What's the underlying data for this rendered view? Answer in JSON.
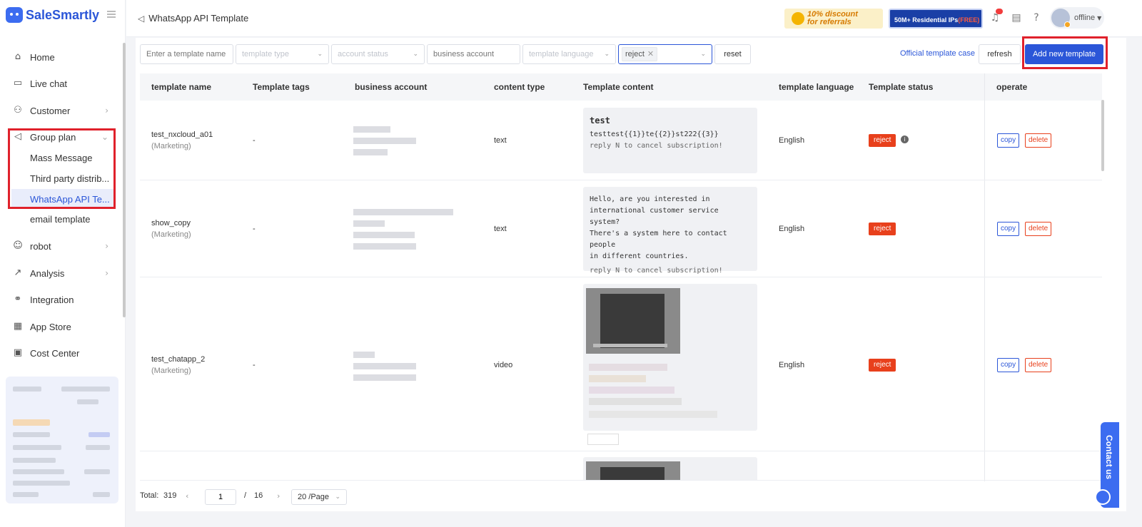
{
  "app": {
    "name": "SaleSmartly"
  },
  "header": {
    "page_title": "WhatsApp API Template",
    "promo_discount": "10% discount for referrals",
    "promo_discount_line1": "10% discount",
    "promo_discount_line2": "for referrals",
    "promo_ips": "50M+ Residential IPs",
    "promo_ips_free": "(FREE)",
    "user_status": "offline"
  },
  "sidebar": {
    "items": [
      {
        "label": "Home",
        "icon": "home-icon"
      },
      {
        "label": "Live chat",
        "icon": "chat-icon"
      },
      {
        "label": "Customer",
        "icon": "users-icon"
      },
      {
        "label": "Group plan",
        "icon": "send-icon"
      },
      {
        "label": "robot",
        "icon": "robot-icon"
      },
      {
        "label": "Analysis",
        "icon": "chart-icon"
      },
      {
        "label": "Integration",
        "icon": "integration-icon"
      },
      {
        "label": "App Store",
        "icon": "apps-icon"
      },
      {
        "label": "Cost Center",
        "icon": "wallet-icon"
      }
    ],
    "group_plan_children": [
      {
        "label": "Mass Message"
      },
      {
        "label": "Third party distrib..."
      },
      {
        "label": "WhatsApp API Te..."
      },
      {
        "label": "email template"
      }
    ]
  },
  "filters": {
    "template_name_placeholder": "Enter a template name",
    "template_type_placeholder": "template type",
    "account_status_placeholder": "account status",
    "business_account_placeholder": "business account",
    "template_language_placeholder": "template language",
    "status_selected": "reject",
    "reset_label": "reset"
  },
  "actions": {
    "official_case_link": "Official template case",
    "refresh_label": "refresh",
    "add_label": "Add new template"
  },
  "table": {
    "columns": [
      "template name",
      "Template tags",
      "business account",
      "content type",
      "Template content",
      "template language",
      "Template status",
      "operate"
    ],
    "rows": [
      {
        "name": "test_nxcloud_a01",
        "category": "(Marketing)",
        "tags": "-",
        "content_type": "text",
        "content_header": "test",
        "content_body": "testtest{{1}}te{{2}}st222{{3}}",
        "content_footer": "reply N to cancel subscription!",
        "language": "English",
        "status": "reject",
        "copy": "copy",
        "delete": "delete"
      },
      {
        "name": "show_copy",
        "category": "(Marketing)",
        "tags": "-",
        "content_type": "text",
        "content_body_lines": [
          "Hello, are you interested in",
          "international customer service system?",
          "There's a system here to contact people",
          "in different countries."
        ],
        "content_footer": "reply N to cancel subscription!",
        "language": "English",
        "status": "reject",
        "copy": "copy",
        "delete": "delete"
      },
      {
        "name": "test_chatapp_2",
        "category": "(Marketing)",
        "tags": "-",
        "content_type": "video",
        "language": "English",
        "status": "reject",
        "copy": "copy",
        "delete": "delete"
      }
    ]
  },
  "pagination": {
    "total_label": "Total:",
    "total": "319",
    "current_page": "1",
    "separator": "/",
    "total_pages": "16",
    "page_size": "20 /Page"
  },
  "contact_tab": "Contact us"
}
